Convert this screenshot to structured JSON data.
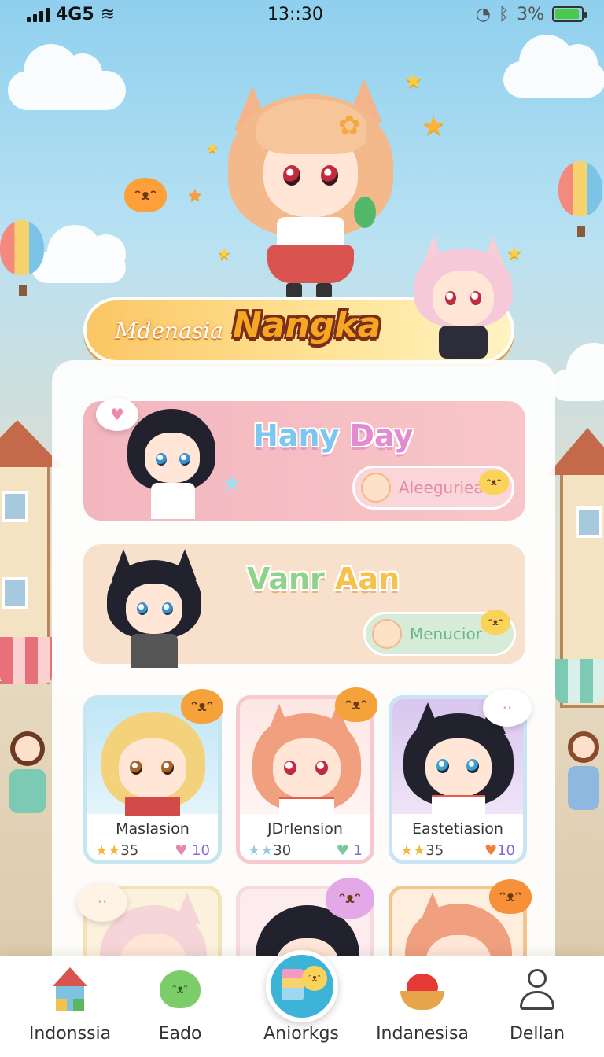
{
  "status_bar": {
    "carrier": "4G5",
    "time": "13::30",
    "battery_percent": "3%",
    "battery_level": 0.95
  },
  "header": {
    "banner_subtitle": "Mdenasia",
    "banner_title": "Nangka"
  },
  "feature_cards": [
    {
      "title_part1": "Hany",
      "title_part2": "Day",
      "pill_label": "Aleeguriea"
    },
    {
      "title_part1": "Vanr",
      "title_part2": "Aan",
      "pill_label": "Menucior"
    }
  ],
  "characters": [
    {
      "name": "Maslasion",
      "stars": "35",
      "likes": "10",
      "heart_icon": "pink-heart-icon"
    },
    {
      "name": "JDrlension",
      "stars": "30",
      "likes": "1",
      "heart_icon": "green-heart-icon"
    },
    {
      "name": "Eastetiasion",
      "stars": "35",
      "likes": "10",
      "heart_icon": "orange-heart-icon"
    }
  ],
  "bottom_nav": [
    {
      "label": "Indonssia",
      "icon": "house-icon"
    },
    {
      "label": "Eado",
      "icon": "blob-mascot-icon"
    },
    {
      "label": "Aniorkgs",
      "icon": "center-action-icon"
    },
    {
      "label": "Indanesisa",
      "icon": "bowl-icon"
    },
    {
      "label": "Dellan",
      "icon": "profile-icon"
    }
  ],
  "colors": {
    "sky": "#8fd0ee",
    "banner": "#fbc664",
    "card_pink": "#f3b6bf",
    "card_beige": "#f7e1cc",
    "nav_center": "#3bb4d8"
  }
}
